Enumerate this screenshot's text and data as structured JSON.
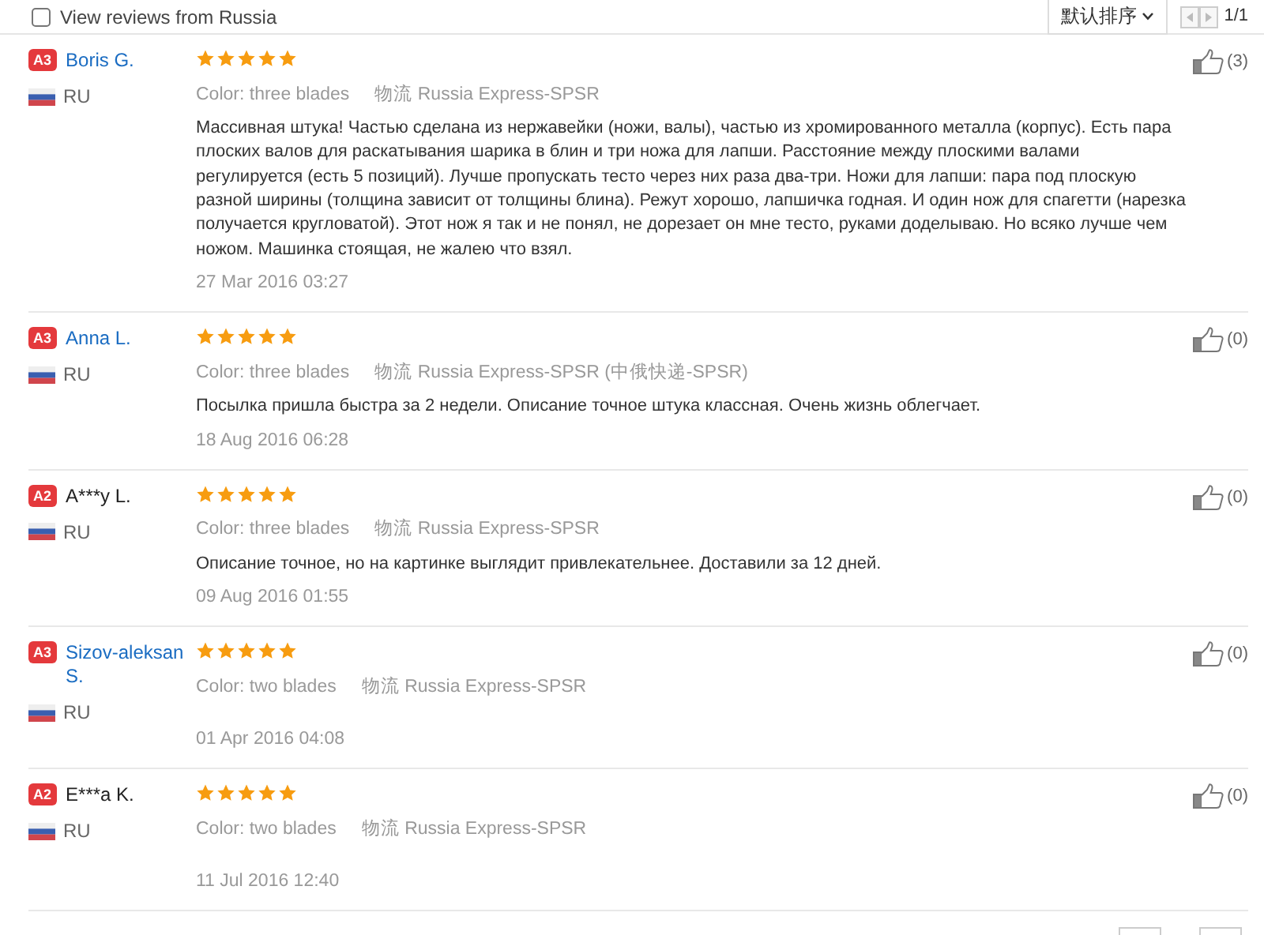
{
  "filter": {
    "label": "View reviews from Russia",
    "checked": false
  },
  "sort": {
    "label": "默认排序"
  },
  "pager": {
    "text": "1/1"
  },
  "reviews": [
    {
      "badge": "A3",
      "name": "Boris G.",
      "linked": true,
      "country": "RU",
      "stars": 5,
      "color_label": "Color:",
      "color_value": "three blades",
      "shipping_label": "物流",
      "shipping": "Russia Express-SPSR",
      "text": "Массивная штука! Частью сделана из нержавейки (ножи, валы), частью из хромированного металла (корпус). Есть пара плоских валов для раскатывания шарика в блин и три ножа для лапши. Расстояние между плоскими валами регулируется (есть 5 позиций). Лучше пропускать тесто через них раза два-три. Ножи для лапши: пара под плоскую разной ширины (толщина зависит от толщины блина). Режут хорошо, лапшичка годная. И один нож для спагетти (нарезка получается кругловатой). Этот нож я так и не понял, не дорезает он мне тесто, руками доделываю. Но всяко лучше чем ножом. Машинка стоящая, не жалею что взял.",
      "date": "27 Mar 2016 03:27",
      "likes": "(3)"
    },
    {
      "badge": "A3",
      "name": "Anna L.",
      "linked": true,
      "country": "RU",
      "stars": 5,
      "color_label": "Color:",
      "color_value": "three blades",
      "shipping_label": "物流",
      "shipping": "Russia Express-SPSR (中俄快递-SPSR)",
      "text": "Посылка пришла быстра за 2 недели. Описание точное штука классная. Очень жизнь облегчает.",
      "date": "18 Aug 2016 06:28",
      "likes": "(0)"
    },
    {
      "badge": "A2",
      "name": "A***y L.",
      "linked": false,
      "country": "RU",
      "stars": 5,
      "color_label": "Color:",
      "color_value": "three blades",
      "shipping_label": "物流",
      "shipping": "Russia Express-SPSR",
      "text": "Описание точное, но на картинке выглядит привлекательнее. Доставили за 12 дней.",
      "date": "09 Aug 2016 01:55",
      "likes": "(0)"
    },
    {
      "badge": "A3",
      "name": "Sizov-aleksan S.",
      "linked": true,
      "country": "RU",
      "stars": 5,
      "color_label": "Color:",
      "color_value": "two blades",
      "shipping_label": "物流",
      "shipping": "Russia Express-SPSR",
      "date": "01 Apr 2016 04:08",
      "likes": "(0)"
    },
    {
      "badge": "A2",
      "name": "E***a K.",
      "linked": false,
      "country": "RU",
      "stars": 5,
      "color_label": "Color:",
      "color_value": "two blades",
      "shipping_label": "物流",
      "shipping": "Russia Express-SPSR",
      "date": "11 Jul 2016 12:40",
      "likes": "(0)"
    }
  ]
}
